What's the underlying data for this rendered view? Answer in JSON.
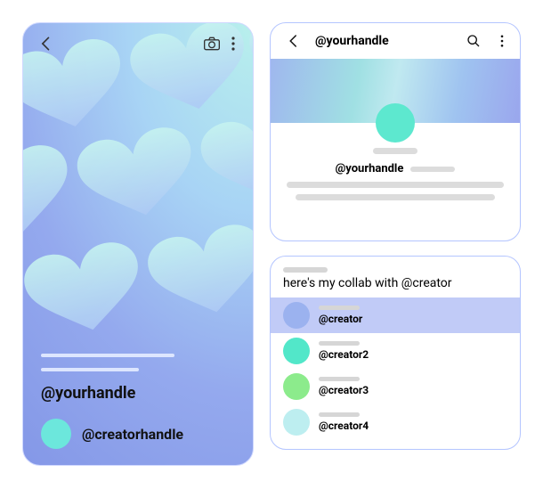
{
  "phone": {
    "primary_handle": "@yourhandle",
    "creator_handle": "@creatorhandle",
    "creator_avatar_color": "#6ce7dc"
  },
  "profile": {
    "title": "@yourhandle",
    "handle": "@yourhandle",
    "avatar_color": "#5de8cf"
  },
  "collab": {
    "caption": "here's my collab with @creator",
    "items": [
      {
        "handle": "@creator",
        "color": "#9bb2ef",
        "selected": true
      },
      {
        "handle": "@creator2",
        "color": "#52e7c9",
        "selected": false
      },
      {
        "handle": "@creator3",
        "color": "#8ceb8c",
        "selected": false
      },
      {
        "handle": "@creator4",
        "color": "#bdeef0",
        "selected": false
      }
    ]
  }
}
